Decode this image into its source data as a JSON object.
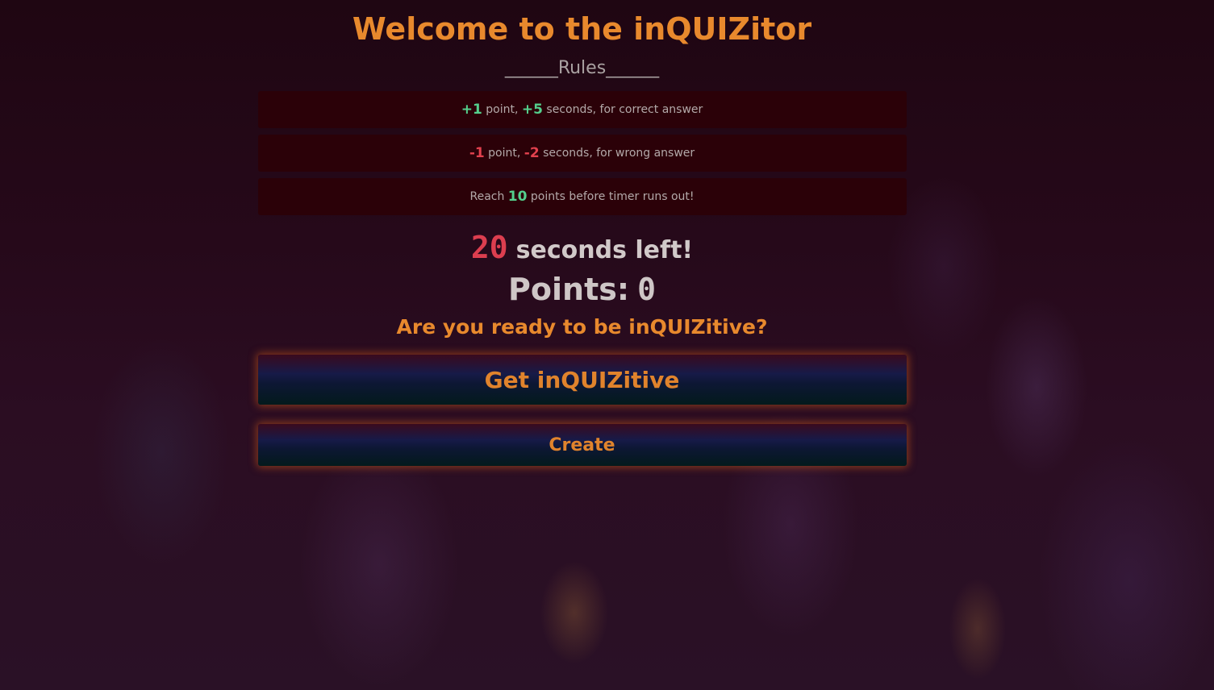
{
  "page": {
    "title": "Welcome to the inQUIZitor",
    "rules_heading": "______Rules______"
  },
  "rules": [
    {
      "parts": [
        {
          "text": "+1",
          "tone": "good"
        },
        {
          "text": " point, ",
          "tone": "plain"
        },
        {
          "text": "+5",
          "tone": "good"
        },
        {
          "text": " seconds, for correct answer",
          "tone": "plain"
        }
      ]
    },
    {
      "parts": [
        {
          "text": "-1",
          "tone": "bad"
        },
        {
          "text": " point, ",
          "tone": "plain"
        },
        {
          "text": "-2",
          "tone": "bad"
        },
        {
          "text": " seconds, for wrong answer",
          "tone": "plain"
        }
      ]
    },
    {
      "parts": [
        {
          "text": "Reach ",
          "tone": "plain"
        },
        {
          "text": "10",
          "tone": "good"
        },
        {
          "text": " points before timer runs out!",
          "tone": "plain"
        }
      ]
    }
  ],
  "timer": {
    "seconds": "20",
    "label": "seconds left!"
  },
  "points": {
    "label": "Points:",
    "value": "0"
  },
  "prompt": "Are you ready to be inQUIZitive?",
  "buttons": {
    "start_label": "Get inQUIZitive",
    "create_label": "Create"
  },
  "colors": {
    "accent": "#e8892d",
    "good": "#54d08d",
    "bad": "#dc3e4f",
    "text": "#cec6c6"
  }
}
